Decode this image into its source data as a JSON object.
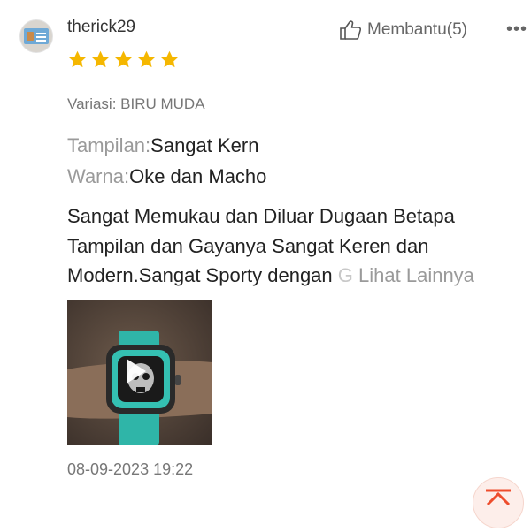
{
  "review": {
    "username": "therick29",
    "helpful_label": "Membantu",
    "helpful_count": "(5)",
    "more_menu": "•••",
    "rating": 5,
    "rating_max": 5,
    "star_color": "#F5B700",
    "variation": "Variasi: BIRU MUDA",
    "attributes": [
      {
        "key": "Tampilan:",
        "value": "Sangat Kern"
      },
      {
        "key": "Warna:",
        "value": "Oke dan Macho"
      }
    ],
    "body_lines": [
      "Sangat Memukau dan Diluar Dugaan Betapa",
      "Tampilan dan Gayanya Sangat Keren dan"
    ],
    "body_last_line": "Modern.Sangat Sporty dengan",
    "body_faded": "G",
    "see_more": "Lihat Lainnya",
    "media": {
      "type": "video",
      "icon": "play-icon"
    },
    "timestamp": "08-09-2023 19:22"
  },
  "accent_color": "#EE4D2D",
  "scroll_top_icon": "arrow-up-to-top-icon"
}
